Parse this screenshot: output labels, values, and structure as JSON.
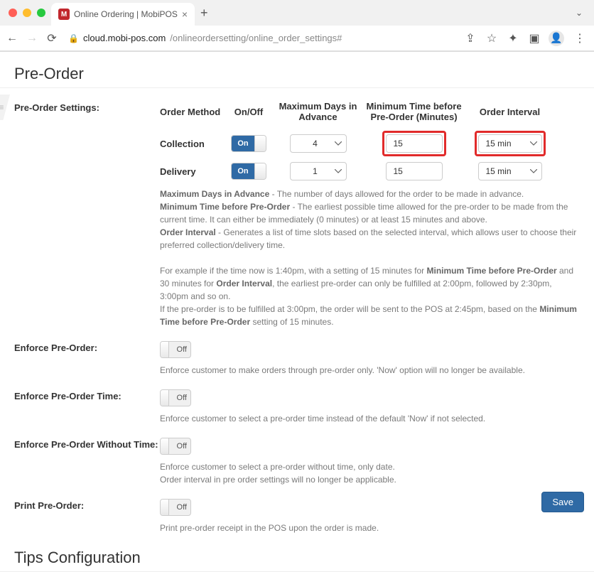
{
  "browser": {
    "tab": {
      "title": "Online Ordering | MobiPOS"
    },
    "url_domain": "cloud.mobi-pos.com",
    "url_path": "/onlineordersetting/online_order_settings#"
  },
  "page": {
    "pre_order_title": "Pre-Order",
    "tips_title": "Tips Configuration",
    "save_label": "Save"
  },
  "preorder_settings": {
    "label": "Pre-Order Settings:",
    "headers": {
      "method": "Order Method",
      "onoff": "On/Off",
      "days": "Maximum Days in Advance",
      "mintime": "Minimum Time before Pre-Order (Minutes)",
      "interval": "Order Interval"
    },
    "rows": {
      "collection": {
        "label": "Collection",
        "on": true,
        "on_label": "On",
        "days": "4",
        "mintime": "15",
        "interval": "15 min"
      },
      "delivery": {
        "label": "Delivery",
        "on": true,
        "on_label": "On",
        "days": "1",
        "mintime": "15",
        "interval": "15 min"
      }
    },
    "desc": {
      "max_days_label": "Maximum Days in Advance",
      "max_days_text": " - The number of days allowed for the order to be made in advance.",
      "min_time_label": "Minimum Time before Pre-Order",
      "min_time_text": " - The earliest possible time allowed for the pre-order to be made from the current time. It can either be immediately (0 minutes) or at least 15 minutes and above.",
      "interval_label": "Order Interval",
      "interval_text": " - Generates a list of time slots based on the selected interval, which allows user to choose their preferred collection/delivery time.",
      "example_1a": "For example if the time now is 1:40pm, with a setting of 15 minutes for ",
      "example_1b": "Minimum Time before Pre-Order",
      "example_1c": " and 30 minutes for ",
      "example_1d": "Order Interval",
      "example_1e": ", the earliest pre-order can only be fulfilled at 2:00pm, followed by 2:30pm, 3:00pm and so on.",
      "example_2a": "If the pre-order is to be fulfilled at 3:00pm, the order will be sent to the POS at 2:45pm, based on the ",
      "example_2b": "Minimum Time before Pre-Order",
      "example_2c": " setting of 15 minutes."
    }
  },
  "enforce_preorder": {
    "label": "Enforce Pre-Order:",
    "off_label": "Off",
    "desc": "Enforce customer to make orders through pre-order only. 'Now' option will no longer be available."
  },
  "enforce_preorder_time": {
    "label": "Enforce Pre-Order Time:",
    "off_label": "Off",
    "desc": "Enforce customer to select a pre-order time instead of the default 'Now' if not selected."
  },
  "enforce_preorder_without_time": {
    "label": "Enforce Pre-Order Without Time:",
    "off_label": "Off",
    "desc1": "Enforce customer to select a pre-order without time, only date.",
    "desc2": "Order interval in pre order settings will no longer be applicable."
  },
  "print_preorder": {
    "label": "Print Pre-Order:",
    "off_label": "Off",
    "desc": "Print pre-order receipt in the POS upon the order is made."
  }
}
